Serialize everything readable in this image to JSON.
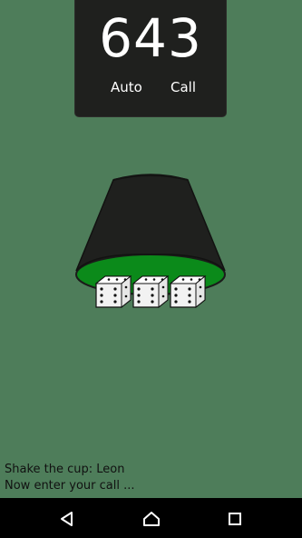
{
  "score_panel": {
    "value": "643",
    "auto_label": "Auto",
    "call_label": "Call"
  },
  "cup": {
    "color": "#1f201e",
    "felt_color": "#0b8a1a",
    "dice_faces": [
      6,
      6,
      6
    ]
  },
  "status": {
    "line1": "Shake the cup: Leon",
    "line2": "Now enter your call ..."
  },
  "navbar": {
    "back_icon": "back-triangle-icon",
    "home_icon": "home-icon",
    "recent_icon": "recent-apps-icon"
  },
  "colors": {
    "background": "#4e7d5a",
    "panel": "#1f201e",
    "felt": "#0b8a1a",
    "navbar": "#000000"
  }
}
